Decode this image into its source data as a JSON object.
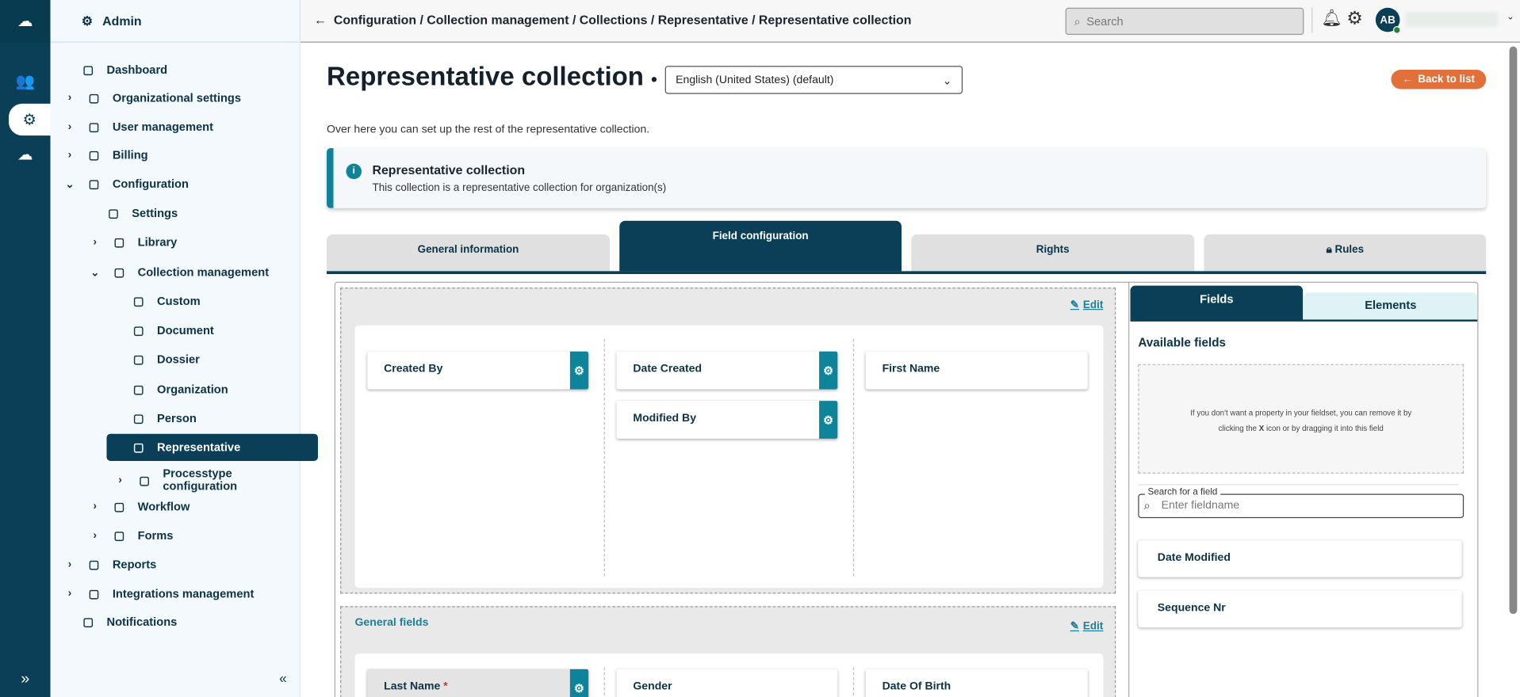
{
  "sidebar": {
    "header": "Admin",
    "items": [
      {
        "label": "Dashboard",
        "icon": "dashboard-icon"
      },
      {
        "label": "Organizational settings",
        "icon": "building-icon"
      },
      {
        "label": "User management",
        "icon": "user-gear-icon"
      },
      {
        "label": "Billing",
        "icon": "card-icon"
      },
      {
        "label": "Configuration",
        "icon": "config-icon"
      },
      {
        "label": "Settings",
        "icon": "gear-icon"
      },
      {
        "label": "Library",
        "icon": "library-icon"
      },
      {
        "label": "Collection management",
        "icon": "layers-icon"
      },
      {
        "label": "Custom",
        "icon": "custom-icon"
      },
      {
        "label": "Document",
        "icon": "document-icon"
      },
      {
        "label": "Dossier",
        "icon": "dossier-icon"
      },
      {
        "label": "Organization",
        "icon": "organization-icon"
      },
      {
        "label": "Person",
        "icon": "person-icon"
      },
      {
        "label": "Representative",
        "icon": "representative-icon"
      },
      {
        "label": "Processtype configuration",
        "icon": "process-icon"
      },
      {
        "label": "Workflow",
        "icon": "workflow-icon"
      },
      {
        "label": "Forms",
        "icon": "forms-icon"
      },
      {
        "label": "Reports",
        "icon": "reports-icon"
      },
      {
        "label": "Integrations management",
        "icon": "puzzle-icon"
      },
      {
        "label": "Notifications",
        "icon": "bell-icon"
      }
    ]
  },
  "topbar": {
    "breadcrumb": "Configuration / Collection management / Collections / Representative / Representative collection",
    "search_placeholder": "Search",
    "avatar": "AB"
  },
  "page": {
    "title": "Representative collection",
    "language": "English (United States) (default)",
    "back": "Back to list",
    "description": "Over here you can set up the rest of the representative collection."
  },
  "info": {
    "title": "Representative collection",
    "text": "This collection is a representative collection for organization(s)"
  },
  "tabs": [
    "General information",
    "Field configuration",
    "Rights",
    "Rules"
  ],
  "fieldsets": [
    {
      "title": "",
      "edit": "Edit",
      "columns": [
        [
          "Created By"
        ],
        [
          "Date Created",
          "Modified By"
        ],
        [
          "First Name"
        ]
      ]
    },
    {
      "title": "General fields",
      "edit": "Edit",
      "columns": [
        [
          "Last Name"
        ],
        [
          "Gender"
        ],
        [
          "Date Of Birth"
        ]
      ]
    }
  ],
  "right": {
    "tabs": [
      "Fields",
      "Elements"
    ],
    "heading": "Available fields",
    "hint1": "If you don't want a property in your fieldset, you can remove it by",
    "hint2a": "clicking the ",
    "hint2b": "X",
    "hint2c": " icon or by dragging it into this field",
    "search_label": "Search for a field",
    "search_placeholder": "Enter fieldname",
    "fields": [
      "Date Modified",
      "Sequence Nr"
    ]
  },
  "colors": {
    "primary": "#0a3f57",
    "accent": "#0e849a",
    "orange": "#e2703a"
  }
}
